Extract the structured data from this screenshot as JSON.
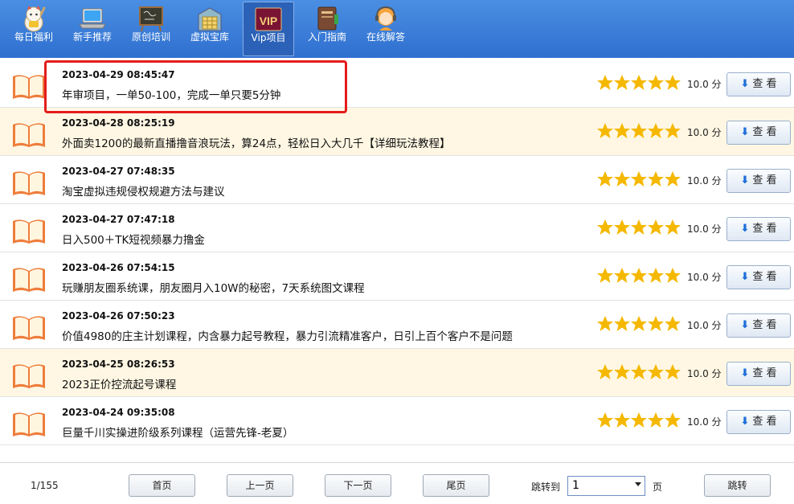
{
  "nav": [
    {
      "label": "每日福利",
      "icon": "lucky-cat-icon"
    },
    {
      "label": "新手推荐",
      "icon": "laptop-icon"
    },
    {
      "label": "原创培训",
      "icon": "blackboard-icon"
    },
    {
      "label": "虚拟宝库",
      "icon": "treasure-shelf-icon"
    },
    {
      "label": "Vip项目",
      "icon": "vip-badge-icon",
      "badge": "VIP",
      "active": true
    },
    {
      "label": "入门指南",
      "icon": "guide-book-icon"
    },
    {
      "label": "在线解答",
      "icon": "support-agent-icon"
    }
  ],
  "items": [
    {
      "date": "2023-04-29 08:45:47",
      "title": "年审项目，一单50-100，完成一单只要5分钟",
      "score": "10.0 分",
      "button": "查 看",
      "rating": 5
    },
    {
      "date": "2023-04-28 08:25:19",
      "title": "外面卖1200的最新直播撸音浪玩法，算24点，轻松日入大几千【详细玩法教程】",
      "score": "10.0 分",
      "button": "查 看",
      "rating": 5
    },
    {
      "date": "2023-04-27 07:48:35",
      "title": "淘宝虚拟违规侵权规避方法与建议",
      "score": "10.0 分",
      "button": "查 看",
      "rating": 5
    },
    {
      "date": "2023-04-27 07:47:18",
      "title": "日入500＋TK短视频暴力撸金",
      "score": "10.0 分",
      "button": "查 看",
      "rating": 5
    },
    {
      "date": "2023-04-26 07:54:15",
      "title": "玩赚朋友圈系统课，朋友圈月入10W的秘密，7天系统图文课程",
      "score": "10.0 分",
      "button": "查 看",
      "rating": 5
    },
    {
      "date": "2023-04-26 07:50:23",
      "title": "价值4980的庄主计划课程，内含暴力起号教程，暴力引流精准客户，日引上百个客户不是问题",
      "score": "10.0 分",
      "button": "查 看",
      "rating": 5
    },
    {
      "date": "2023-04-25 08:26:53",
      "title": "2023正价控流起号课程",
      "score": "10.0 分",
      "button": "查 看",
      "rating": 5
    },
    {
      "date": "2023-04-24 09:35:08",
      "title": "巨量千川实操进阶级系列课程（运营先锋-老夏）",
      "score": "10.0 分",
      "button": "查 看",
      "rating": 5
    }
  ],
  "pager": {
    "count": "1/155",
    "first": "首页",
    "prev": "上一页",
    "next": "下一页",
    "last": "尾页",
    "jump_label": "跳转到",
    "jump_value": "1",
    "unit": "页",
    "go": "跳转"
  },
  "colors": {
    "topbar": "#3a7fd9",
    "alt_row": "#fff7e3",
    "star": "#f5b800",
    "highlight": "#e41c1c"
  }
}
